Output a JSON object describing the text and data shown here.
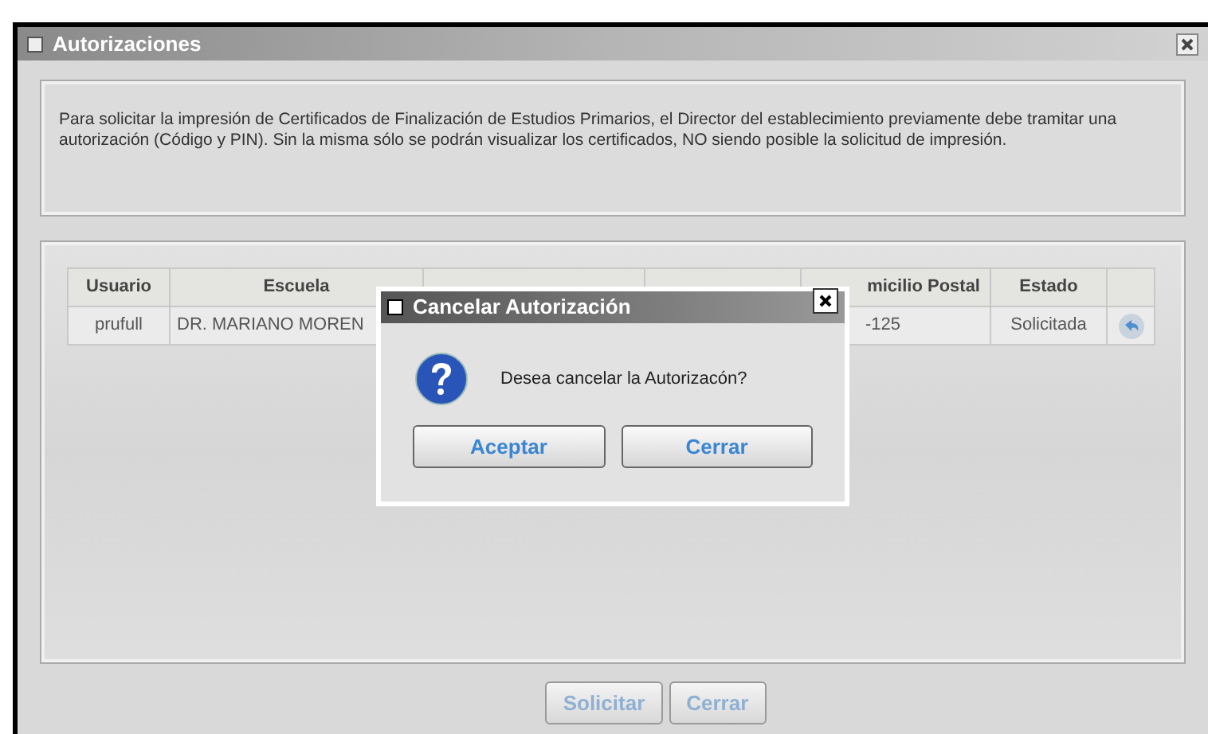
{
  "window": {
    "title": "Autorizaciones"
  },
  "info_text": "Para solicitar la impresión de Certificados de Finalización de Estudios Primarios, el Director del establecimiento previamente debe tramitar una autorización (Código y PIN). Sin la misma sólo se podrán visualizar los certificados, NO siendo posible la solicitud de impresión.",
  "table": {
    "columns": [
      "Usuario",
      "Escuela",
      "",
      "",
      "micilio Postal",
      "Estado"
    ],
    "rows": [
      {
        "cells": [
          "prufull",
          "DR. MARIANO MOREN",
          "",
          "",
          "-125",
          "Solicitada"
        ]
      }
    ]
  },
  "buttons": [
    {
      "label": "Solicitar",
      "disabled": true
    },
    {
      "label": "Cerrar",
      "disabled": true
    }
  ],
  "dialog": {
    "title": "Cancelar Autorización",
    "message": "Desea cancelar la Autorizacón?",
    "buttons": [
      "Aceptar",
      "Cerrar"
    ]
  }
}
